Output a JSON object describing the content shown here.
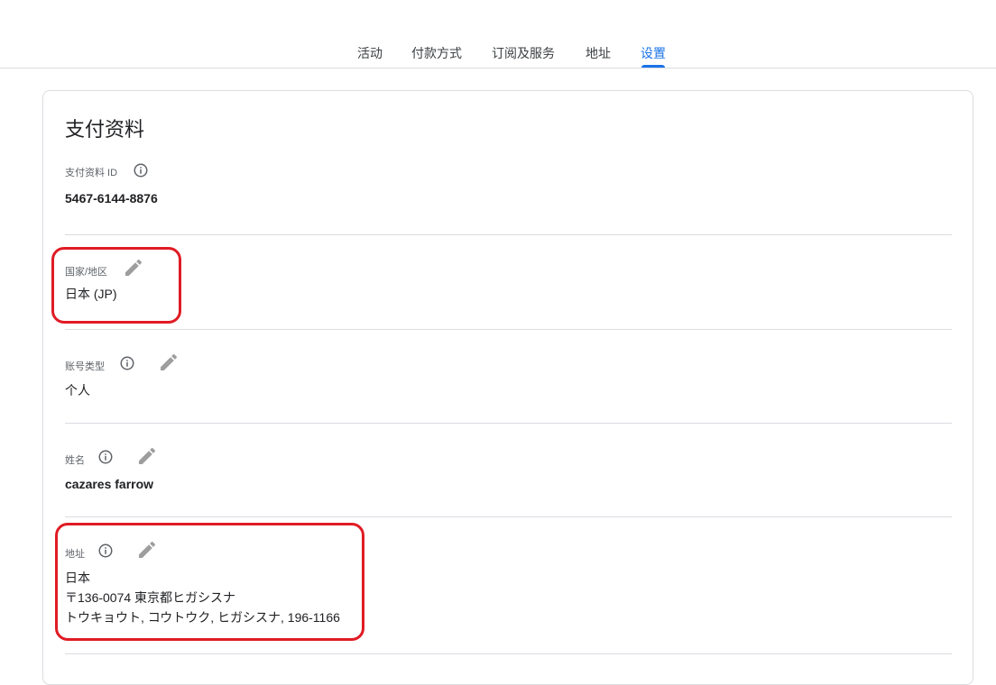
{
  "tabs": [
    {
      "label": "活动"
    },
    {
      "label": "付款方式"
    },
    {
      "label": "订阅及服务"
    },
    {
      "label": "地址"
    },
    {
      "label": "设置",
      "active": true
    }
  ],
  "card": {
    "title": "支付资料",
    "payment_profile_id": {
      "label": "支付资料 ID",
      "value": "5467-6144-8876"
    },
    "country": {
      "label": "国家/地区",
      "value": "日本 (JP)"
    },
    "account_type": {
      "label": "账号类型",
      "value": "个人"
    },
    "name": {
      "label": "姓名",
      "value": "cazares farrow"
    },
    "address": {
      "label": "地址",
      "line1": "日本",
      "line2": "〒136-0074 東京都ヒガシスナ",
      "line3": "トウキョウト, コウトウク, ヒガシスナ, 196-1166"
    }
  },
  "icons": {
    "info": "info-icon",
    "edit": "pencil-edit-icon"
  },
  "colors": {
    "accent": "#1a73e8",
    "highlight": "#e01b24",
    "divider": "#dadce0",
    "icon": "#9e9e9e"
  }
}
